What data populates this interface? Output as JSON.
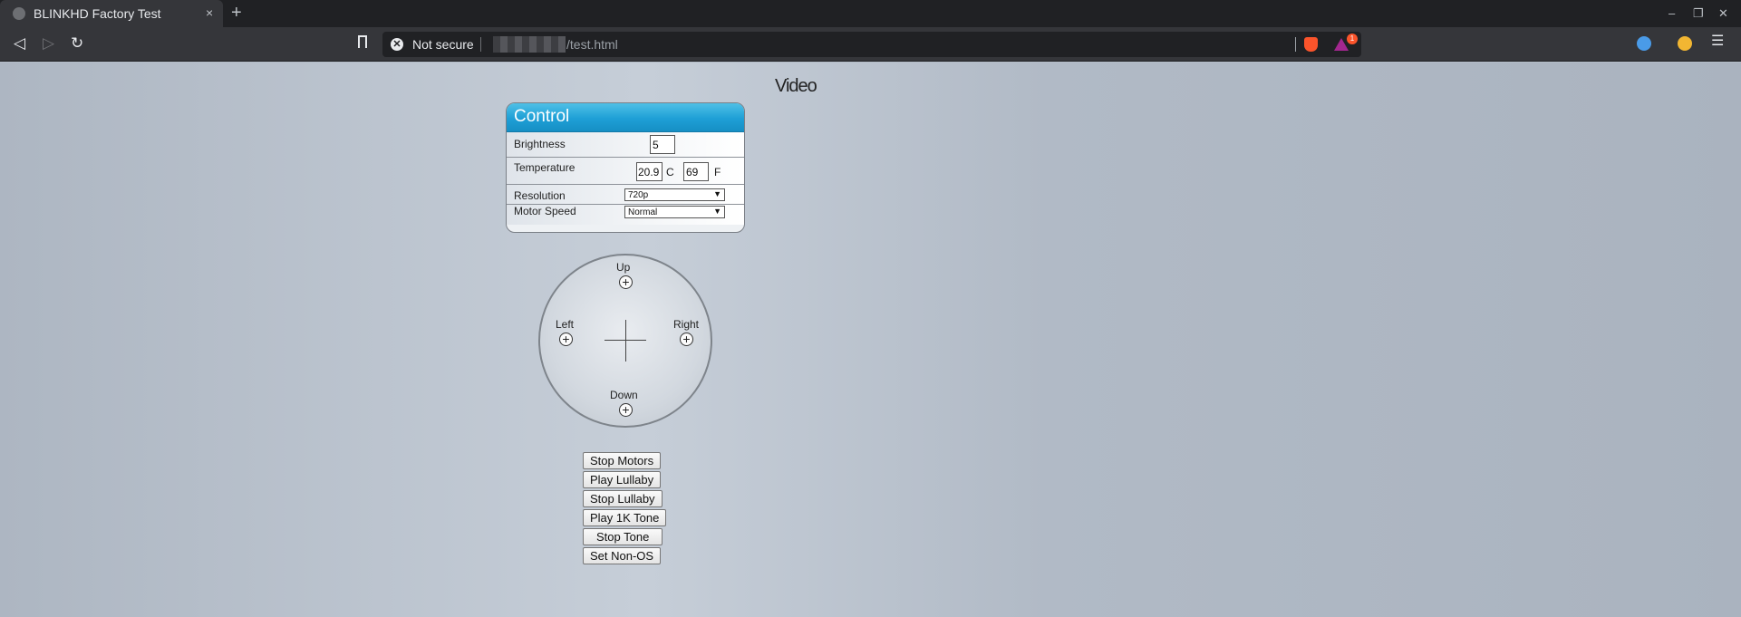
{
  "browser": {
    "tab_title": "BLINKHD Factory Test",
    "tab_close": "×",
    "new_tab": "+",
    "window_controls": {
      "minimize": "–",
      "restore": "❐",
      "close": "✕"
    },
    "nav": {
      "back": "◁",
      "forward": "▷",
      "reload": "↻"
    },
    "security_text": "Not secure",
    "security_icon": "✕",
    "url": "/test.html",
    "rewards_badge": "1",
    "menu": "☰"
  },
  "page": {
    "heading": "Video",
    "control": {
      "title": "Control",
      "brightness": {
        "label": "Brightness",
        "value": "5"
      },
      "temperature": {
        "label": "Temperature",
        "celsius": "20.9",
        "celsius_unit": "C",
        "fahrenheit": "69",
        "fahrenheit_unit": "F"
      },
      "resolution": {
        "label": "Resolution",
        "selected": "720p"
      },
      "motor_speed": {
        "label": "Motor Speed",
        "selected": "Normal"
      },
      "dropdown_arrow": "▼"
    },
    "dpad": {
      "up": "Up",
      "down": "Down",
      "left": "Left",
      "right": "Right",
      "button_glyph": "+"
    },
    "buttons": {
      "stop_motors": "Stop Motors",
      "play_lullaby": "Play Lullaby",
      "stop_lullaby": "Stop Lullaby",
      "play_1k_tone": "Play 1K Tone",
      "stop_tone": "Stop Tone",
      "set_non_os": "Set Non-OS"
    }
  }
}
